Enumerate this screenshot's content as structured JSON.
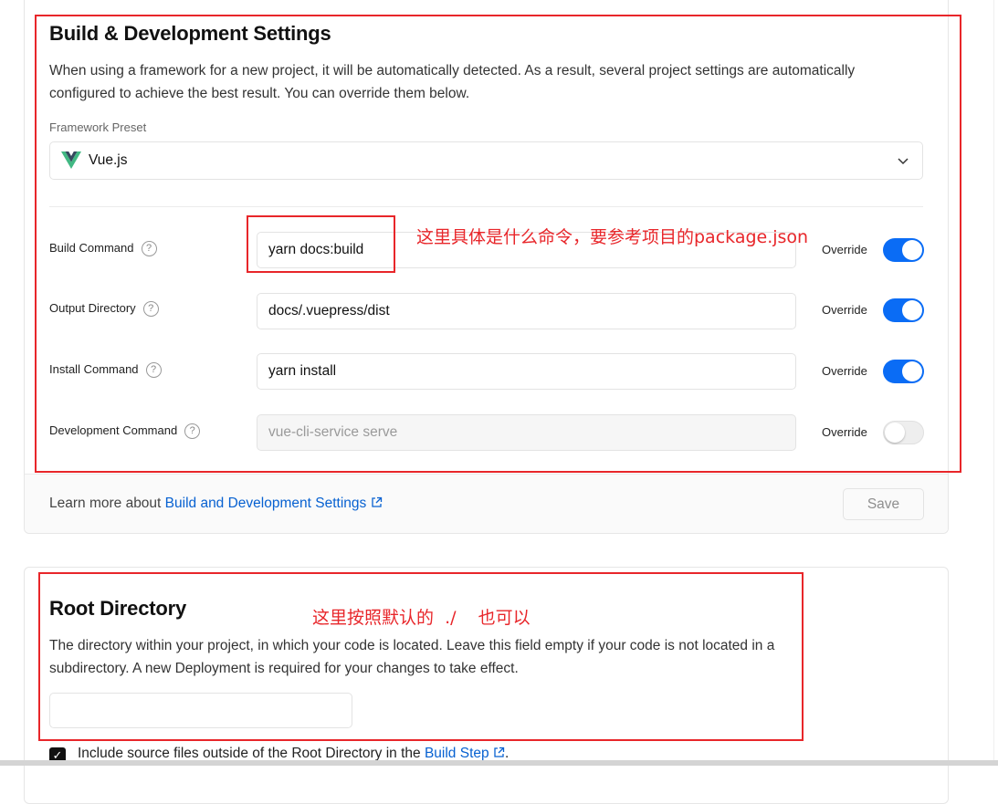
{
  "build_section": {
    "title": "Build & Development Settings",
    "description_line1": "When using a framework for a new project, it will be automatically detected. As a result, several project settings are automatically",
    "description_line2": "configured to achieve the best result. You can override them below.",
    "framework_preset_label": "Framework Preset",
    "framework_preset_value": "Vue.js",
    "rows": [
      {
        "label": "Build Command",
        "value": "yarn docs:build",
        "override_label": "Override",
        "override_on": true
      },
      {
        "label": "Output Directory",
        "value": "docs/.vuepress/dist",
        "override_label": "Override",
        "override_on": true
      },
      {
        "label": "Install Command",
        "value": "yarn install",
        "override_label": "Override",
        "override_on": true
      },
      {
        "label": "Development Command",
        "placeholder": "vue-cli-service serve",
        "override_label": "Override",
        "override_on": false
      }
    ],
    "help_glyph": "?",
    "learn_more_prefix": "Learn more about ",
    "learn_more_link": "Build and Development Settings",
    "save_label": "Save"
  },
  "root_section": {
    "title": "Root Directory",
    "description_line1": "The directory within your project, in which your code is located. Leave this field empty if your code is not located in a",
    "description_line2": "subdirectory. A new Deployment is required for your changes to take effect.",
    "input_value": "",
    "checkbox_checked": true,
    "checkbox_label_prefix": "Include source files outside of the Root Directory in the ",
    "checkbox_label_link": "Build Step",
    "checkbox_label_suffix": "."
  },
  "annotations": {
    "note_build": "这里具体是什么命令，要参考项目的package.json",
    "note_root": "这里按照默认的  ./    也可以",
    "color": "#e8262a"
  },
  "colors": {
    "accent": "#0a6cf5",
    "link": "#0761d1",
    "vue_green": "#41b883",
    "vue_dark": "#35495e"
  }
}
